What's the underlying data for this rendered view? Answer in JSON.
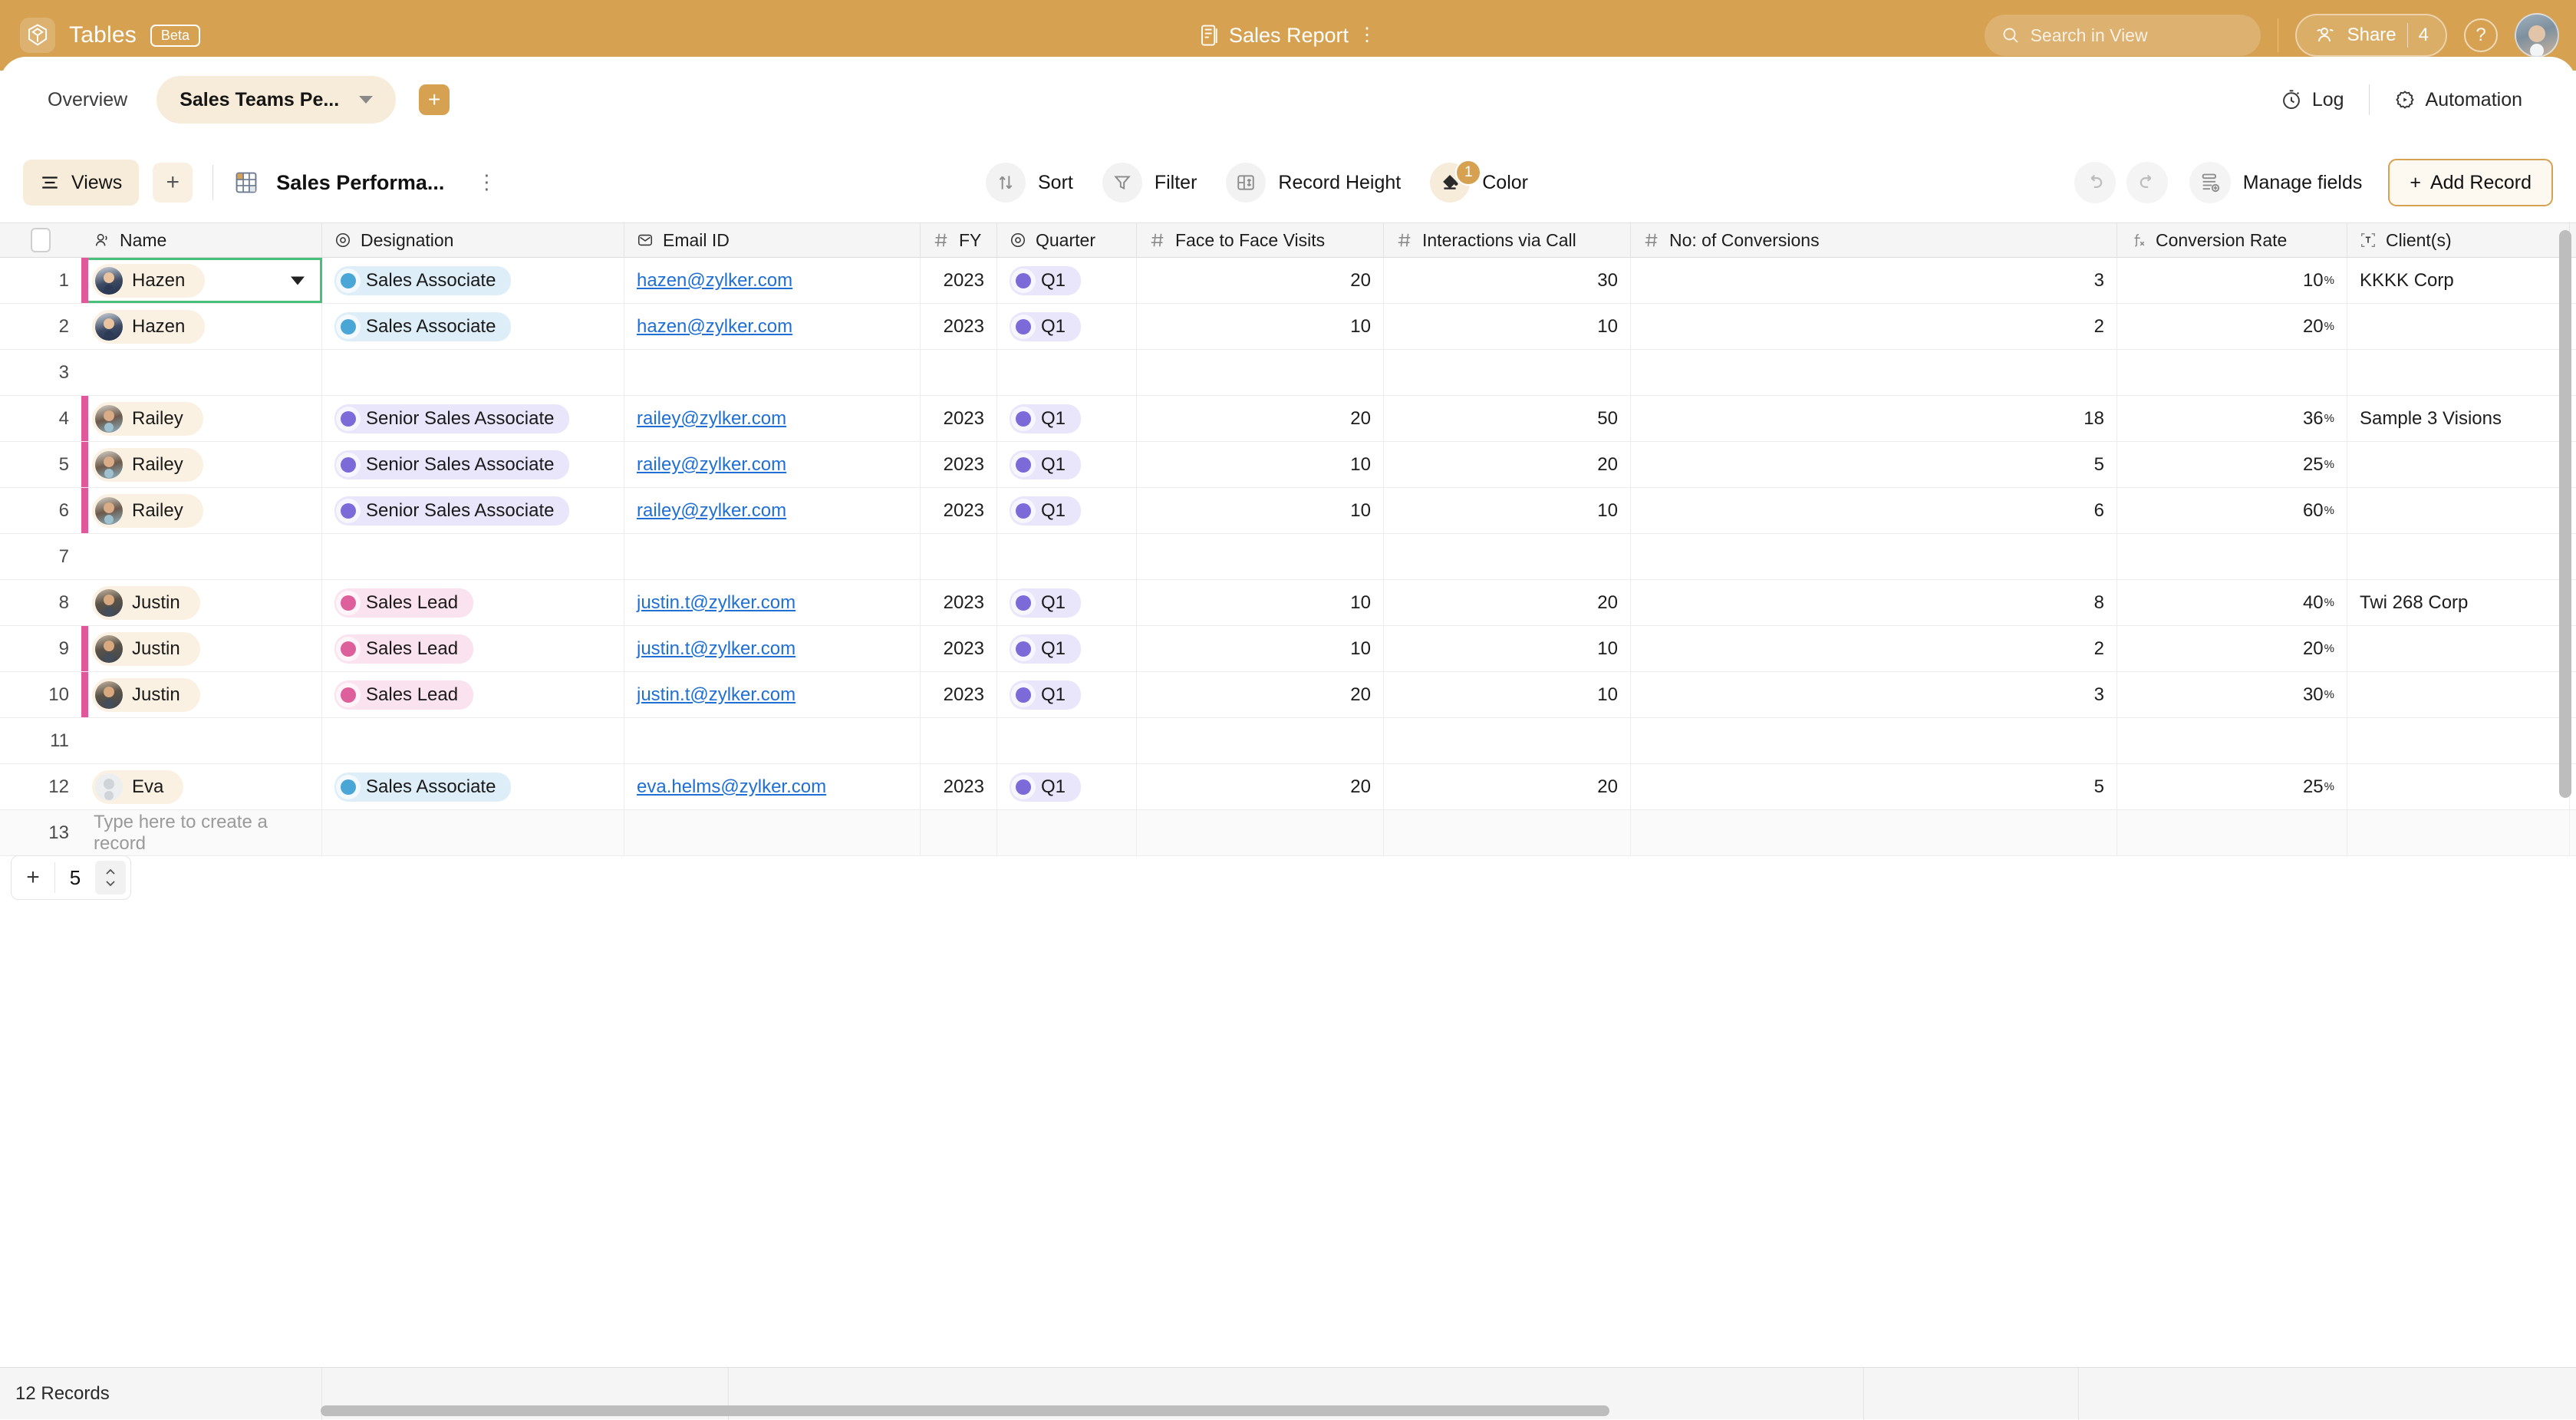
{
  "app": {
    "brand": "Tables",
    "beta_label": "Beta",
    "logo_icon": "tables-logo-icon",
    "accent": "#d6a252"
  },
  "header": {
    "doc_icon": "document-icon",
    "doc_title": "Sales Report",
    "kebab_icon": "more-vertical-icon",
    "search": {
      "icon": "search-icon",
      "placeholder": "Search in View",
      "value": ""
    },
    "share": {
      "icon": "share-people-icon",
      "label": "Share",
      "count": "4"
    },
    "help_icon": "help-circle-icon",
    "avatar": "user-avatar"
  },
  "tabs": {
    "overview_label": "Overview",
    "active_label": "Sales Teams Pe...",
    "caret_icon": "chevron-down-icon",
    "add_icon": "plus-icon",
    "log": {
      "icon": "log-clock-icon",
      "label": "Log"
    },
    "automation": {
      "icon": "automation-gear-icon",
      "label": "Automation"
    }
  },
  "toolbar": {
    "views": {
      "icon": "views-list-icon",
      "label": "Views"
    },
    "add_view_icon": "plus-icon",
    "table_icon": "table-grid-icon",
    "table_name": "Sales Performa...",
    "table_menu_icon": "more-vertical-icon",
    "sort": {
      "icon": "sort-arrows-icon",
      "label": "Sort"
    },
    "filter": {
      "icon": "filter-funnel-icon",
      "label": "Filter"
    },
    "record_height": {
      "icon": "record-height-icon",
      "label": "Record Height"
    },
    "color": {
      "icon": "color-bucket-icon",
      "label": "Color",
      "badge": "1"
    },
    "undo_icon": "undo-icon",
    "redo_icon": "redo-icon",
    "manage_fields": {
      "icon": "manage-fields-icon",
      "label": "Manage fields"
    },
    "add_record": {
      "icon": "plus-icon",
      "label": "Add Record"
    }
  },
  "table": {
    "columns": [
      {
        "label": "Name",
        "icon": "person-field-icon"
      },
      {
        "label": "Designation",
        "icon": "single-select-icon"
      },
      {
        "label": "Email ID",
        "icon": "email-field-icon"
      },
      {
        "label": "FY",
        "icon": "number-field-icon"
      },
      {
        "label": "Quarter",
        "icon": "single-select-icon"
      },
      {
        "label": "Face to Face Visits",
        "icon": "number-field-icon"
      },
      {
        "label": "Interactions via Call",
        "icon": "number-field-icon"
      },
      {
        "label": "No: of Conversions",
        "icon": "number-field-icon"
      },
      {
        "label": "Conversion Rate",
        "icon": "formula-field-icon"
      },
      {
        "label": "Client(s)",
        "icon": "text-field-icon"
      }
    ],
    "rows": [
      {
        "n": "1",
        "name": "Hazen",
        "avatar": "av-hazen",
        "bar": "#e0589a",
        "designation": "Sales Associate",
        "desig_color": "blue",
        "email": "hazen@zylker.com",
        "fy": "2023",
        "quarter": "Q1",
        "f2f": "20",
        "calls": "30",
        "conversions": "3",
        "rate": "10",
        "client": "KKKK Corp",
        "selected": true
      },
      {
        "n": "2",
        "name": "Hazen",
        "avatar": "av-hazen",
        "bar": "",
        "designation": "Sales Associate",
        "desig_color": "blue",
        "email": "hazen@zylker.com",
        "fy": "2023",
        "quarter": "Q1",
        "f2f": "10",
        "calls": "10",
        "conversions": "2",
        "rate": "20",
        "client": "",
        "selected": false
      },
      {
        "n": "3",
        "name": "",
        "avatar": "",
        "bar": "",
        "designation": "",
        "desig_color": "",
        "email": "",
        "fy": "",
        "quarter": "",
        "f2f": "",
        "calls": "",
        "conversions": "",
        "rate": "",
        "client": "",
        "selected": false
      },
      {
        "n": "4",
        "name": "Railey",
        "avatar": "av-railey",
        "bar": "#e0589a",
        "designation": "Senior Sales Associate",
        "desig_color": "purple",
        "email": "railey@zylker.com",
        "fy": "2023",
        "quarter": "Q1",
        "f2f": "20",
        "calls": "50",
        "conversions": "18",
        "rate": "36",
        "client": "Sample 3 Visions",
        "selected": false
      },
      {
        "n": "5",
        "name": "Railey",
        "avatar": "av-railey",
        "bar": "#e0589a",
        "designation": "Senior Sales Associate",
        "desig_color": "purple",
        "email": "railey@zylker.com",
        "fy": "2023",
        "quarter": "Q1",
        "f2f": "10",
        "calls": "20",
        "conversions": "5",
        "rate": "25",
        "client": "",
        "selected": false
      },
      {
        "n": "6",
        "name": "Railey",
        "avatar": "av-railey",
        "bar": "#e0589a",
        "designation": "Senior Sales Associate",
        "desig_color": "purple",
        "email": "railey@zylker.com",
        "fy": "2023",
        "quarter": "Q1",
        "f2f": "10",
        "calls": "10",
        "conversions": "6",
        "rate": "60",
        "client": "",
        "selected": false
      },
      {
        "n": "7",
        "name": "",
        "avatar": "",
        "bar": "",
        "designation": "",
        "desig_color": "",
        "email": "",
        "fy": "",
        "quarter": "",
        "f2f": "",
        "calls": "",
        "conversions": "",
        "rate": "",
        "client": "",
        "selected": false
      },
      {
        "n": "8",
        "name": "Justin",
        "avatar": "av-justin",
        "bar": "",
        "designation": "Sales Lead",
        "desig_color": "pink",
        "email": "justin.t@zylker.com",
        "fy": "2023",
        "quarter": "Q1",
        "f2f": "10",
        "calls": "20",
        "conversions": "8",
        "rate": "40",
        "client": "Twi 268 Corp",
        "selected": false
      },
      {
        "n": "9",
        "name": "Justin",
        "avatar": "av-justin",
        "bar": "#e0589a",
        "designation": "Sales Lead",
        "desig_color": "pink",
        "email": "justin.t@zylker.com",
        "fy": "2023",
        "quarter": "Q1",
        "f2f": "10",
        "calls": "10",
        "conversions": "2",
        "rate": "20",
        "client": "",
        "selected": false
      },
      {
        "n": "10",
        "name": "Justin",
        "avatar": "av-justin",
        "bar": "#e0589a",
        "designation": "Sales Lead",
        "desig_color": "pink",
        "email": "justin.t@zylker.com",
        "fy": "2023",
        "quarter": "Q1",
        "f2f": "20",
        "calls": "10",
        "conversions": "3",
        "rate": "30",
        "client": "",
        "selected": false
      },
      {
        "n": "11",
        "name": "",
        "avatar": "",
        "bar": "",
        "designation": "",
        "desig_color": "",
        "email": "",
        "fy": "",
        "quarter": "",
        "f2f": "",
        "calls": "",
        "conversions": "",
        "rate": "",
        "client": "",
        "selected": false
      },
      {
        "n": "12",
        "name": "Eva",
        "avatar": "av-eva",
        "bar": "",
        "designation": "Sales Associate",
        "desig_color": "blue",
        "email": "eva.helms@zylker.com",
        "fy": "2023",
        "quarter": "Q1",
        "f2f": "20",
        "calls": "20",
        "conversions": "5",
        "rate": "25",
        "client": "",
        "selected": false
      }
    ],
    "new_row": {
      "n": "13",
      "placeholder": "Type here to create a record"
    },
    "percent_symbol": "%"
  },
  "stepper": {
    "plus_icon": "plus-icon",
    "value": "5",
    "arrows_icon": "stepper-arrows-icon"
  },
  "footer": {
    "records_text": "12 Records"
  }
}
